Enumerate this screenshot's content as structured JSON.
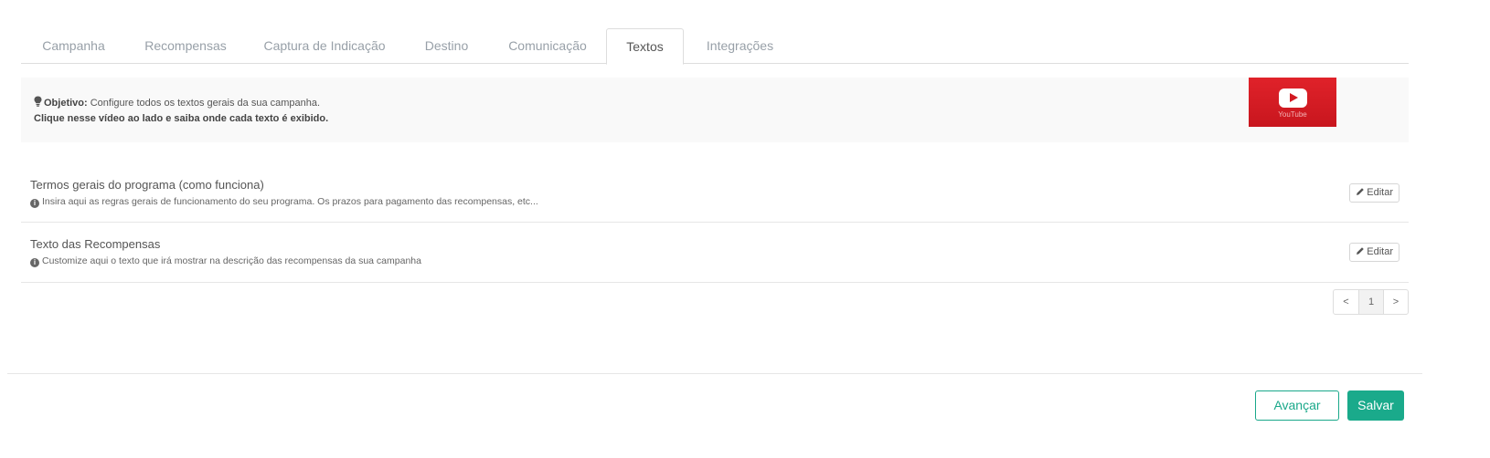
{
  "tabs": [
    {
      "label": "Campanha"
    },
    {
      "label": "Recompensas"
    },
    {
      "label": "Captura de Indicação"
    },
    {
      "label": "Destino"
    },
    {
      "label": "Comunicação"
    },
    {
      "label": "Textos",
      "active": true
    },
    {
      "label": "Integrações"
    }
  ],
  "info": {
    "objective_label": "Objetivo:",
    "objective_text": "Configure todos os textos gerais da sua campanha.",
    "video_hint": "Clique nesse vídeo ao lado e saiba onde cada texto é exibido."
  },
  "video": {
    "label": "YouTube"
  },
  "items": [
    {
      "title": "Termos gerais do programa (como funciona)",
      "description": "Insira aqui as regras gerais de funcionamento do seu programa. Os prazos para pagamento das recompensas, etc...",
      "edit_label": "Editar"
    },
    {
      "title": "Texto das Recompensas",
      "description": "Customize aqui o texto que irá mostrar na descrição das recompensas da sua campanha",
      "edit_label": "Editar"
    }
  ],
  "pagination": {
    "prev": "<",
    "current": "1",
    "next": ">"
  },
  "footer": {
    "advance_label": "Avançar",
    "save_label": "Salvar"
  },
  "colors": {
    "accent": "#1aaa8b",
    "youtube": "#d21a22"
  }
}
